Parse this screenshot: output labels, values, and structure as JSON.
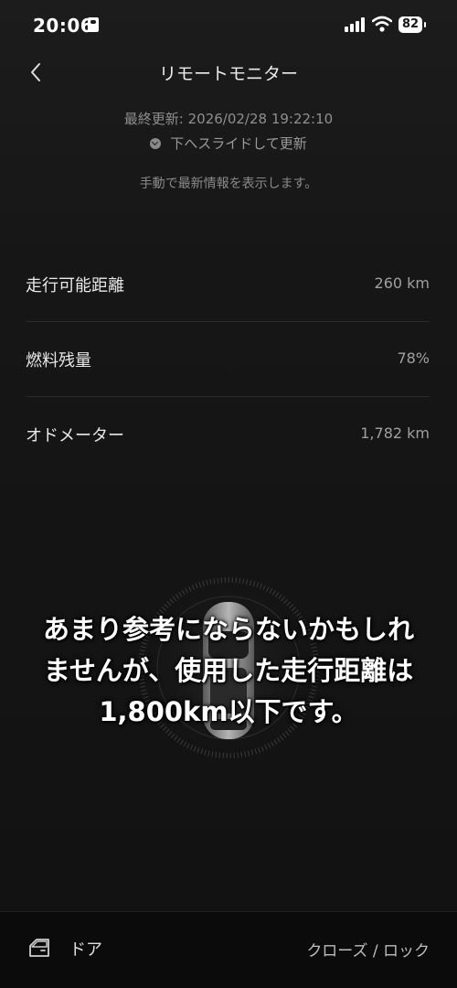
{
  "status_bar": {
    "time": "20:06",
    "battery": "82"
  },
  "header": {
    "title": "リモートモニター"
  },
  "update": {
    "last_updated": "最終更新: 2026/02/28 19:22:10",
    "slide_hint": "下へスライドして更新",
    "manual_note": "手動で最新情報を表示します。"
  },
  "rows": [
    {
      "label": "走行可能距離",
      "value": "260 km"
    },
    {
      "label": "燃料残量",
      "value": "78%"
    },
    {
      "label": "オドメーター",
      "value": "1,782 km"
    }
  ],
  "caption": {
    "line1": "あまり参考にならないかもしれ",
    "line2": "ませんが、使用した走行距離は",
    "line3": "1,800km以下です。"
  },
  "bottom_bar": {
    "door_label": "ドア",
    "lock_label": "クローズ / ロック"
  }
}
